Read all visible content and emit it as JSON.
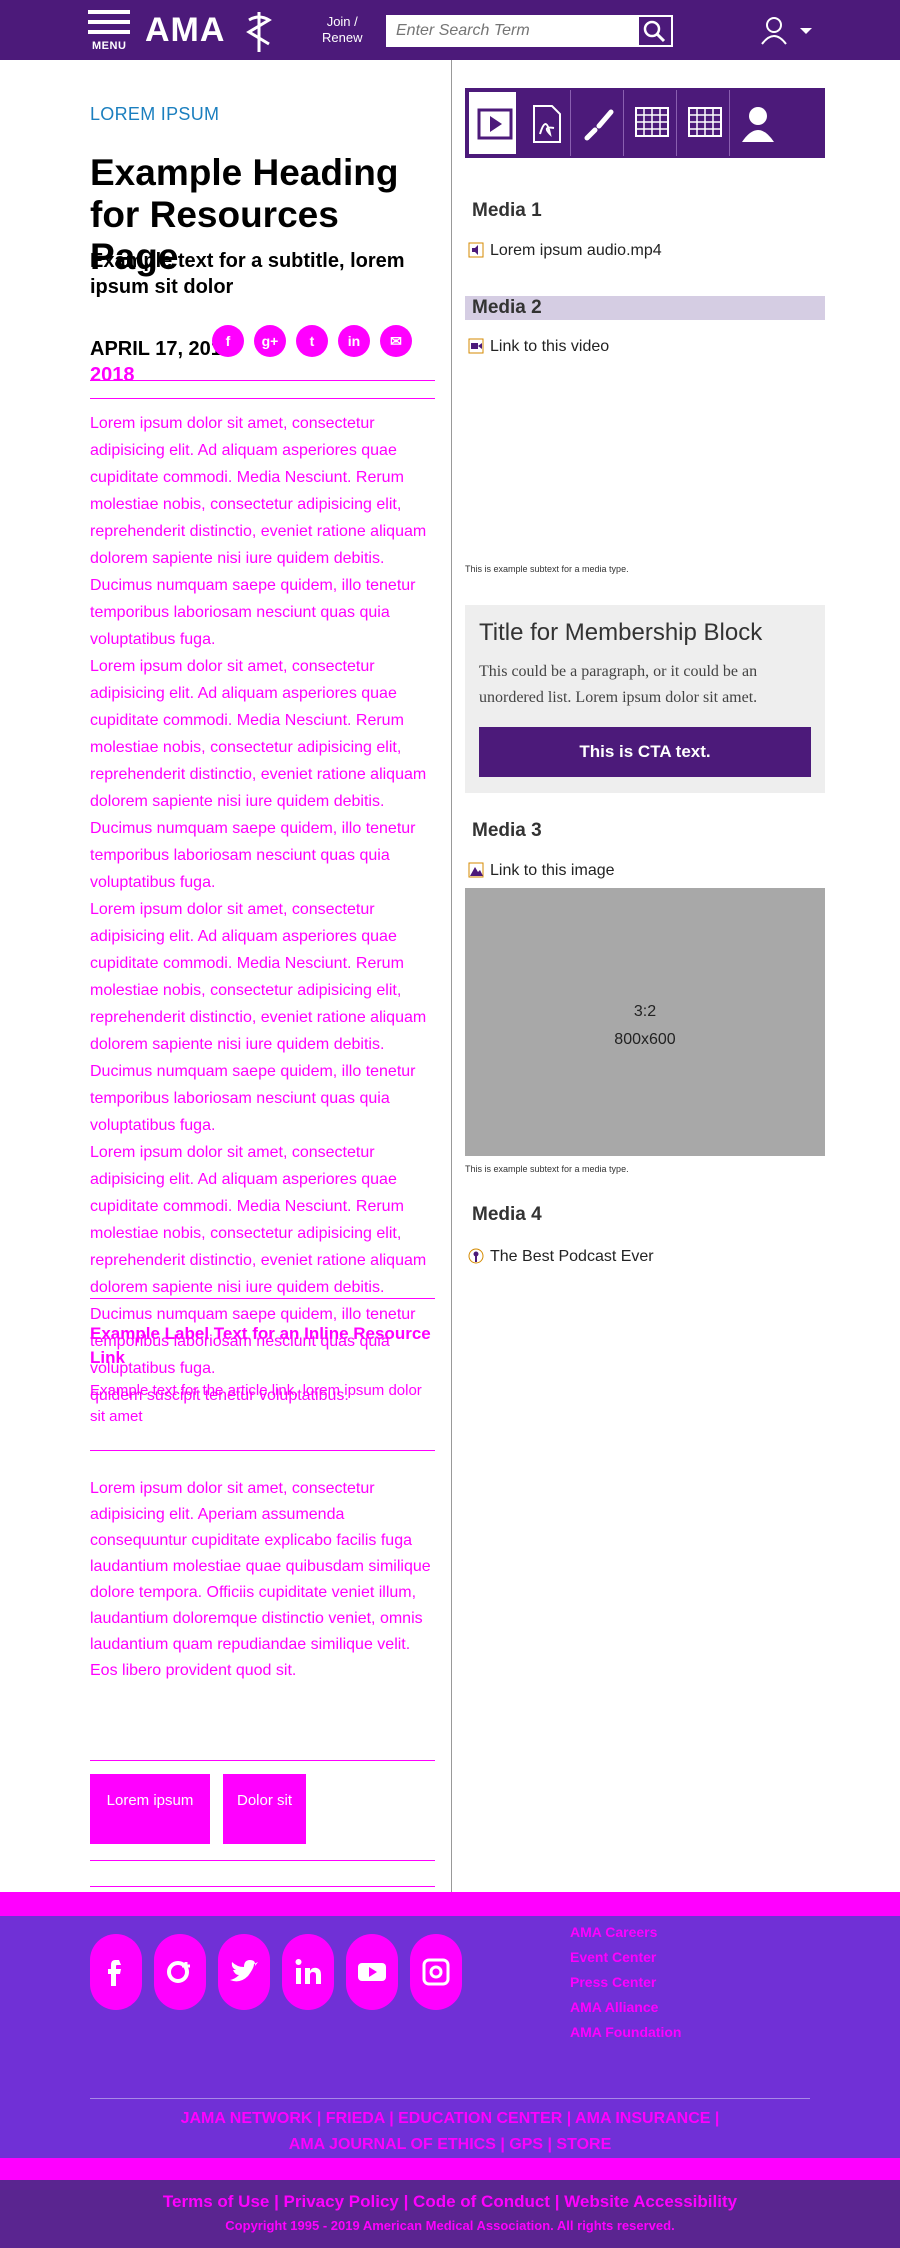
{
  "header": {
    "menu_label": "MENU",
    "logo_text": "AMA",
    "join_label_1": "Join /",
    "join_label_2": "Renew",
    "search_placeholder": "Enter Search Term"
  },
  "article": {
    "eyebrow": "LOREM IPSUM",
    "title": "Example Heading for Resources Page",
    "subtitle": "Example text for a subtitle, lorem ipsum sit dolor",
    "date": "APRIL 17, 2018",
    "date_overflow": "2018",
    "share": [
      "f",
      "g+",
      "t",
      "in",
      "✉"
    ],
    "body": "Lorem ipsum dolor sit amet, consectetur adipisicing elit. Ad aliquam asperiores quae cupiditate commodi. Media Nesciunt. Rerum molestiae nobis, consectetur adipisicing elit, reprehenderit distinctio, eveniet ratione aliquam dolorem sapiente nisi iure quidem debitis. Ducimus numquam saepe quidem, illo tenetur temporibus laboriosam nesciunt quas quia voluptatibus fuga.",
    "body_end": "quidem suscipit tenetur voluptatibus.",
    "inline_label": "Example Label Text for an Inline Resource Link",
    "inline_desc": "Example text for the article link, lorem ipsum dolor sit amet",
    "body2": "Lorem ipsum dolor sit amet, consectetur adipisicing elit. Aperiam assumenda consequuntur cupiditate explicabo facilis fuga laudantium molestiae quae quibusdam similique dolore tempora. Officiis cupiditate veniet illum, laudantium doloremque distinctio veniet, omnis laudantium quam repudiandae similique velit. Eos libero provident quod sit.",
    "tags": [
      "Lorem ipsum",
      "Dolor sit"
    ]
  },
  "media": {
    "tab_icons": [
      "play-icon",
      "pdf-icon",
      "link-icon",
      "table-icon",
      "grid-icon",
      "person-icon"
    ],
    "m1_title": "Media 1",
    "m1_link": "Lorem ipsum audio.mp4",
    "m2_title": "Media 2",
    "m2_link": "Link to this video",
    "caption": "This is example subtext for a media type.",
    "membership_title": "Title for Membership Block",
    "membership_text": "This could be a paragraph, or it could be an unordered list. Lorem ipsum dolor sit amet.",
    "cta": "This is CTA text.",
    "m3_title": "Media 3",
    "m3_link": "Link to this image",
    "image_ratio": "3:2",
    "image_size": "800x600",
    "m4_title": "Media 4",
    "m4_link": "The Best Podcast Ever"
  },
  "footer": {
    "social": [
      "facebook-icon",
      "google-plus-icon",
      "twitter-icon",
      "linkedin-icon",
      "youtube-icon",
      "instagram-icon"
    ],
    "links": [
      "AMA Careers",
      "Event Center",
      "Press Center",
      "AMA Alliance",
      "AMA Foundation"
    ],
    "network_1": "JAMA NETWORK  |  FRIEDA  |  EDUCATION CENTER  |  AMA INSURANCE  |",
    "network_2": "AMA JOURNAL OF ETHICS  |  GPS  |  STORE",
    "legal_links": "Terms of Use  |  Privacy Policy  |  Code of Conduct  |  Website Accessibility",
    "copyright": "Copyright 1995 - 2019 American Medical Association. All rights reserved."
  }
}
